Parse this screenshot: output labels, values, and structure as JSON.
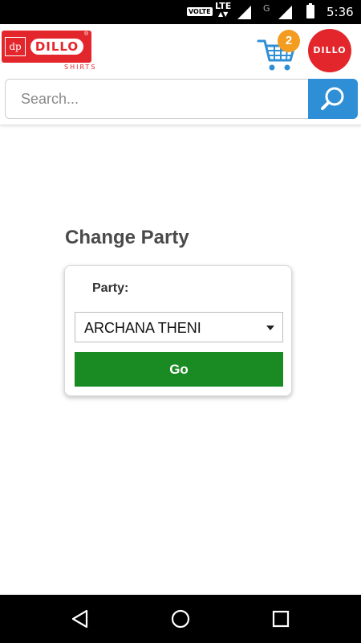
{
  "status_bar": {
    "volte": "VOLTE",
    "network": "LTE",
    "secondary_network": "G",
    "time": "5:36"
  },
  "header": {
    "logo": {
      "brand": "DILLO",
      "subtitle": "SHIRTS",
      "mark": "dp"
    },
    "cart_count": "2",
    "avatar_text": "DILLO",
    "search": {
      "placeholder": "Search...",
      "value": ""
    }
  },
  "main": {
    "title": "Change Party",
    "party_label": "Party:",
    "party_selected": "ARCHANA THENI",
    "go_label": "Go"
  },
  "colors": {
    "brand_red": "#e3262c",
    "search_blue": "#2f8fd6",
    "go_green": "#1a8a23",
    "badge_orange": "#f39c1f"
  },
  "icons": [
    "cart-icon",
    "search-icon",
    "back-icon",
    "home-icon",
    "recents-icon",
    "dropdown-caret-icon"
  ]
}
